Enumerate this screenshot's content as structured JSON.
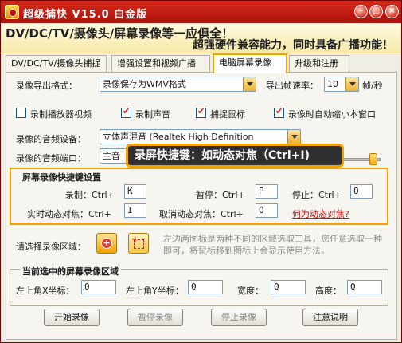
{
  "window": {
    "title": "超级捕快 V15.0 白金版",
    "min": "–",
    "max": "▢",
    "close": "×"
  },
  "banner": {
    "line1": "DV/DC/TV/摄像头/屏幕录像等一应俱全！",
    "line2": "超强硬件兼容能力，同时具备广播功能！"
  },
  "tabs": [
    {
      "label": "DV/DC/TV/摄像头捕捉"
    },
    {
      "label": "增强设置和视频广播"
    },
    {
      "label": "电脑屏幕录像",
      "active": true
    },
    {
      "label": "升级和注册"
    }
  ],
  "export": {
    "label": "录像导出格式：",
    "value": "录像保存为WMV格式",
    "fps_label": "导出帧速率：",
    "fps_value": "10",
    "fps_unit": "帧/秒"
  },
  "options": [
    {
      "label": "录制播放器视频",
      "checked": false
    },
    {
      "label": "录制声音",
      "checked": true
    },
    {
      "label": "捕捉鼠标",
      "checked": true
    },
    {
      "label": "录像时自动缩小本窗口",
      "checked": true
    }
  ],
  "audio": {
    "device_label": "录像的音频设备：",
    "device_value": "立体声混音 (Realtek High Definition",
    "port_label": "录像的音频端口：",
    "port_value": "主音"
  },
  "tooltip": "录屏快捷键：如动态对焦（Ctrl+I)",
  "hotkeys": {
    "title": "屏幕录像快捷键设置",
    "record_label": "录制：Ctrl+",
    "record_key": "K",
    "pause_label": "暂停：Ctrl+",
    "pause_key": "P",
    "stop_label": "停止：Ctrl+",
    "stop_key": "Q",
    "focus_label": "实时动态对焦：Ctrl+",
    "focus_key": "I",
    "cancel_focus_label": "取消动态对焦：Ctrl+",
    "cancel_focus_key": "O",
    "what_link": "何为动态对焦?"
  },
  "area": {
    "label": "请选择录像区域：",
    "hint": "左边两图标是两种不同的区域选取工具，您任意选取一种即可，将鼠标移到图标上会显示使用方法。"
  },
  "region": {
    "title": "当前选中的屏幕录像区域",
    "x_label": "左上角X坐标：",
    "x_value": "0",
    "y_label": "左上角Y坐标：",
    "y_value": "0",
    "w_label": "宽度：",
    "w_value": "0",
    "h_label": "高度：",
    "h_value": "0"
  },
  "buttons": {
    "start": "开始录像",
    "pause": "暂停录像",
    "stop": "停止录像",
    "notes": "注意说明"
  },
  "colors": {
    "accent": "#f2a200",
    "title_bar": "#c21a10",
    "link": "#cc1010"
  }
}
